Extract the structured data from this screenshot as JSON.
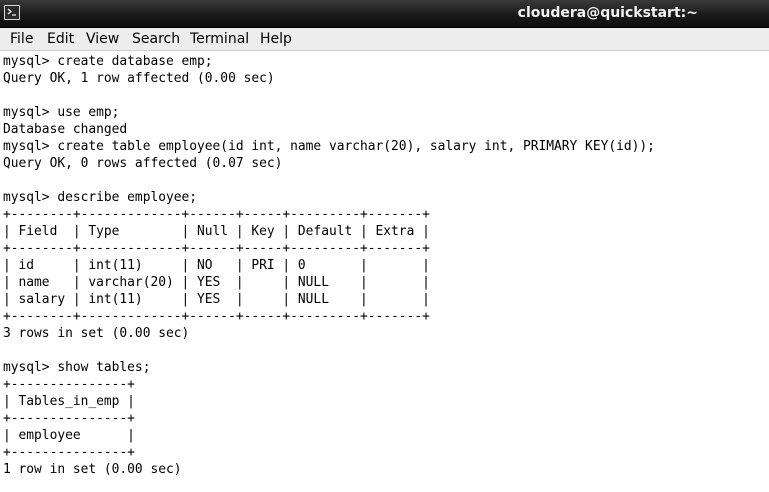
{
  "window": {
    "title": "cloudera@quickstart:~",
    "icon": "terminal-icon"
  },
  "menu": {
    "items": [
      "File",
      "Edit",
      "View",
      "Search",
      "Terminal",
      "Help"
    ]
  },
  "terminal": {
    "lines": [
      "mysql> create database emp;",
      "Query OK, 1 row affected (0.00 sec)",
      "",
      "mysql> use emp;",
      "Database changed",
      "mysql> create table employee(id int, name varchar(20), salary int, PRIMARY KEY(id));",
      "Query OK, 0 rows affected (0.07 sec)",
      "",
      "mysql> describe employee;",
      "+--------+-------------+------+-----+---------+-------+",
      "| Field  | Type        | Null | Key | Default | Extra |",
      "+--------+-------------+------+-----+---------+-------+",
      "| id     | int(11)     | NO   | PRI | 0       |       |",
      "| name   | varchar(20) | YES  |     | NULL    |       |",
      "| salary | int(11)     | YES  |     | NULL    |       |",
      "+--------+-------------+------+-----+---------+-------+",
      "3 rows in set (0.00 sec)",
      "",
      "mysql> show tables;",
      "+---------------+",
      "| Tables_in_emp |",
      "+---------------+",
      "| employee      |",
      "+---------------+",
      "1 row in set (0.00 sec)"
    ]
  }
}
